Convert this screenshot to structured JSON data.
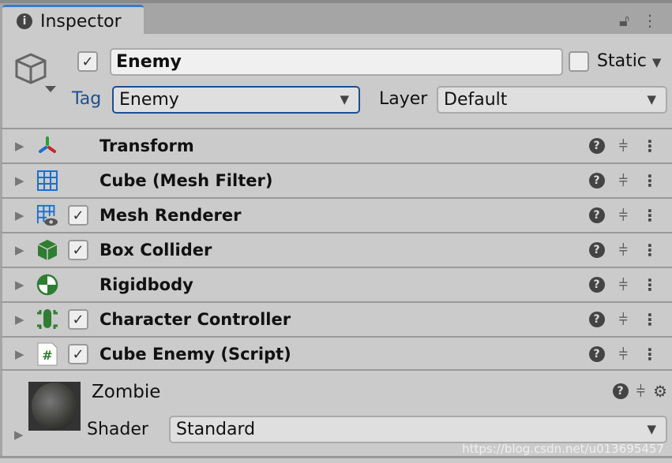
{
  "tab": {
    "title": "Inspector",
    "icon": "info-icon"
  },
  "toolbar": {
    "lock_icon": "lock-icon",
    "menu_icon": "kebab-menu-icon"
  },
  "gameobject": {
    "active": true,
    "name": "Enemy",
    "static_label": "Static",
    "static": false,
    "tag_label": "Tag",
    "tag": "Enemy",
    "layer_label": "Layer",
    "layer": "Default"
  },
  "components": [
    {
      "label": "Transform",
      "icon": "transform-icon",
      "has_checkbox": false
    },
    {
      "label": "Cube (Mesh Filter)",
      "icon": "mesh-filter-icon",
      "has_checkbox": false
    },
    {
      "label": "Mesh Renderer",
      "icon": "mesh-renderer-icon",
      "has_checkbox": true,
      "enabled": true
    },
    {
      "label": "Box Collider",
      "icon": "box-collider-icon",
      "has_checkbox": true,
      "enabled": true
    },
    {
      "label": "Rigidbody",
      "icon": "rigidbody-icon",
      "has_checkbox": false
    },
    {
      "label": "Character Controller",
      "icon": "character-controller-icon",
      "has_checkbox": true,
      "enabled": true
    },
    {
      "label": "Cube Enemy (Script)",
      "icon": "script-icon",
      "has_checkbox": true,
      "enabled": true
    }
  ],
  "material": {
    "name": "Zombie",
    "shader_label": "Shader",
    "shader": "Standard"
  },
  "watermark": "https://blog.csdn.net/u013695457",
  "colors": {
    "accent": "#3a79c9",
    "tag_label": "#1d4f91",
    "green_icon": "#2e7d32",
    "blue_icon": "#1a6fd1"
  }
}
